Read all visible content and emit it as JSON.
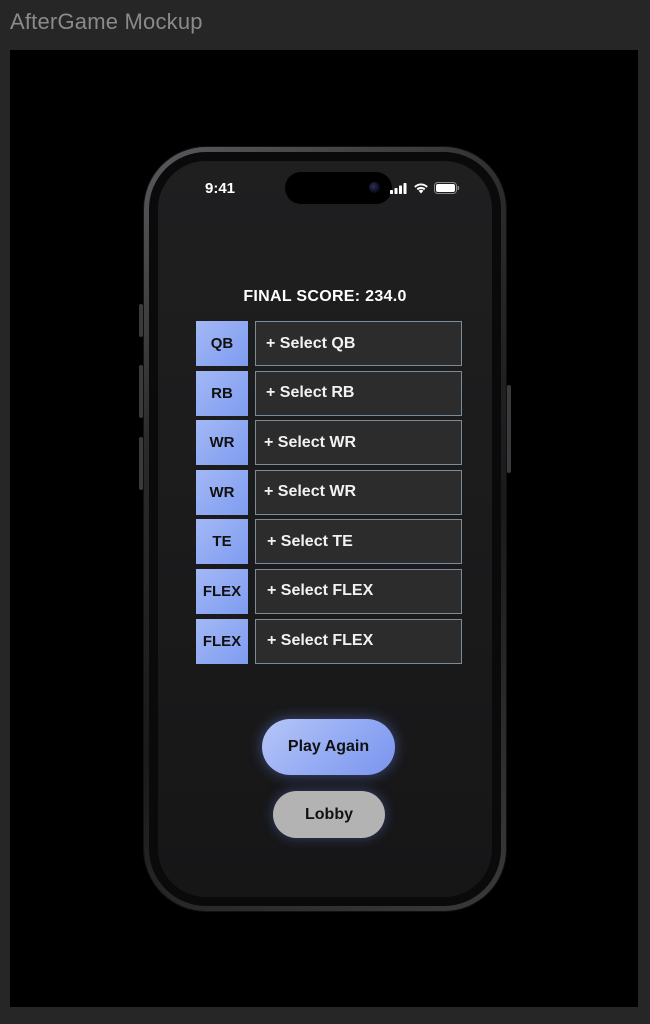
{
  "window": {
    "title": "AfterGame Mockup"
  },
  "status_bar": {
    "time": "9:41",
    "icons": [
      "signal-icon",
      "wifi-icon",
      "battery-icon"
    ]
  },
  "final_score": "FINAL SCORE: 234.0",
  "roster": [
    {
      "position": "QB",
      "slot_label": "+ Select QB"
    },
    {
      "position": "RB",
      "slot_label": "+ Select RB"
    },
    {
      "position": "WR",
      "slot_label": "+ Select WR"
    },
    {
      "position": "WR",
      "slot_label": "+ Select WR"
    },
    {
      "position": "TE",
      "slot_label": "+ Select TE"
    },
    {
      "position": "FLEX",
      "slot_label": "+ Select FLEX"
    },
    {
      "position": "FLEX",
      "slot_label": "+ Select FLEX"
    }
  ],
  "buttons": {
    "play_again": "Play Again",
    "lobby": "Lobby"
  },
  "colors": {
    "accent_blue": "#8fa7f2",
    "slot_bg": "#2c2c2d",
    "slot_border": "#7a8c9a",
    "lobby_gray": "#b3b3b3"
  }
}
